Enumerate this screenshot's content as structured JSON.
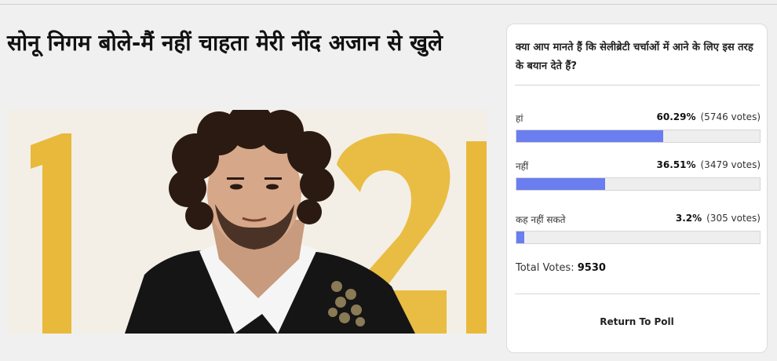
{
  "article": {
    "headline": "सोनू निगम बोले-मैं नहीं चाहता मेरी नींद अजान से खुले"
  },
  "poll": {
    "question": "क्या आप मानते हैं कि सेलीब्रेटी चर्चाओं में आने के लिए इस तरह के बयान देते हैं?",
    "options": [
      {
        "label": "हां",
        "percent": "60.29%",
        "votes": "(5746 votes)",
        "fraction": 0.6029
      },
      {
        "label": "नहीं",
        "percent": "36.51%",
        "votes": "(3479 votes)",
        "fraction": 0.3651
      },
      {
        "label": "कह नहीं सकते",
        "percent": "3.2%",
        "votes": "(305 votes)",
        "fraction": 0.032
      }
    ],
    "total_label": "Total Votes:",
    "total_value": "9530",
    "return_label": "Return To Poll"
  },
  "colors": {
    "bar_fill": "#6a7ef0",
    "bar_track": "#eeeeee",
    "background": "#f0f0f0"
  }
}
